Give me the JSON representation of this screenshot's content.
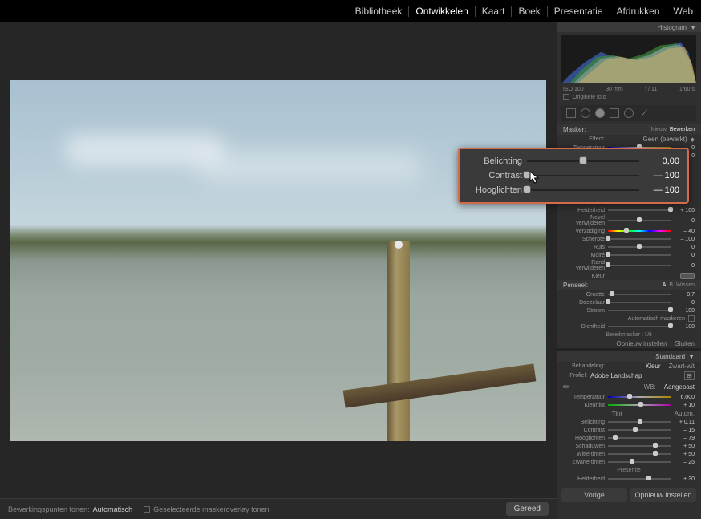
{
  "nav": {
    "items": [
      "Bibliotheek",
      "Ontwikkelen",
      "Kaart",
      "Boek",
      "Presentatie",
      "Afdrukken",
      "Web"
    ],
    "active_index": 1
  },
  "histogram": {
    "title": "Histogram",
    "meta": {
      "iso": "ISO 100",
      "focal": "30 mm",
      "aperture": "f / 11",
      "shutter": "1/60 s"
    },
    "original_checkbox": "Originele foto"
  },
  "mask_panel": {
    "header": "Masker:",
    "new_label": "Nieuw",
    "edit_label": "Bewerken",
    "effect_label": "Effect:",
    "effect_value": "Geen (bewerkt)"
  },
  "popup": {
    "rows": [
      {
        "label": "Belichting",
        "value": "0,00",
        "pos": 50
      },
      {
        "label": "Contrast",
        "value": "— 100",
        "pos": 0
      },
      {
        "label": "Hooglichten",
        "value": "— 100",
        "pos": 0
      }
    ]
  },
  "local": {
    "temp": {
      "label": "Temperatuur",
      "value": "0",
      "pos": 50
    },
    "tint": {
      "label": "Kleurtint",
      "value": "0",
      "pos": 50
    },
    "helder": {
      "label": "Helderheid",
      "value": "+ 100",
      "pos": 100
    },
    "nevel": {
      "label": "Nevel verwijderen",
      "value": "0",
      "pos": 50
    },
    "verz": {
      "label": "Verzadiging",
      "value": "– 40",
      "pos": 30
    },
    "scherp": {
      "label": "Scherpte",
      "value": "– 100",
      "pos": 0
    },
    "ruis": {
      "label": "Ruis",
      "value": "0",
      "pos": 50
    },
    "moire": {
      "label": "Moiré",
      "value": "0",
      "pos": 0
    },
    "rand": {
      "label": "Rand verwijderen",
      "value": "0",
      "pos": 0
    },
    "kleur_label": "Kleur"
  },
  "brush": {
    "header": "Penseel:",
    "a": "A",
    "b": "B",
    "erase": "Wissen",
    "size": {
      "label": "Grootte",
      "value": "0,7",
      "pos": 6
    },
    "feather": {
      "label": "Doezelaar",
      "value": "0",
      "pos": 0
    },
    "flow": {
      "label": "Stroom",
      "value": "100",
      "pos": 100
    },
    "automask": "Automatisch maskeren",
    "density": {
      "label": "Dichtheid",
      "value": "100",
      "pos": 100
    },
    "range": "Bereikmasker : Uit",
    "reset": "Opnieuw instellen",
    "close": "Sluiten"
  },
  "basic": {
    "behandeling": "Behandeling:",
    "kleur": "Kleur",
    "zw": "Zwart-wit",
    "profiel": "Profiel:",
    "profiel_val": "Adobe Landschap",
    "standaard": "Standaard",
    "wb_label": "WB:",
    "wb_val": "Aangepast",
    "temp": {
      "label": "Temperatuur",
      "value": "6.000",
      "pos": 35
    },
    "tint": {
      "label": "Kleurtint",
      "value": "+ 10",
      "pos": 52
    },
    "tint_head": "Tint",
    "tint_auto": "Autom.",
    "belichting": {
      "label": "Belichting",
      "value": "+ 0,11",
      "pos": 51
    },
    "contrast": {
      "label": "Contrast",
      "value": "– 15",
      "pos": 43
    },
    "hooglichten": {
      "label": "Hooglichten",
      "value": "– 79",
      "pos": 11
    },
    "schaduwen": {
      "label": "Schaduwen",
      "value": "+ 50",
      "pos": 75
    },
    "witte": {
      "label": "Witte tinten",
      "value": "+ 50",
      "pos": 75
    },
    "zwarte": {
      "label": "Zwarte tinten",
      "value": "– 25",
      "pos": 38
    },
    "presentie": "Presentie",
    "helderheid": {
      "label": "Helderheid",
      "value": "+ 30",
      "pos": 65
    }
  },
  "footer": {
    "bewerkingspunten": "Bewerkingspunten tonen:",
    "automatisch": "Automatisch",
    "overlay": "Geselecteerde maskeroverlay tonen",
    "gereed": "Gereed",
    "vorige": "Vorige",
    "opnieuw": "Opnieuw instellen"
  }
}
